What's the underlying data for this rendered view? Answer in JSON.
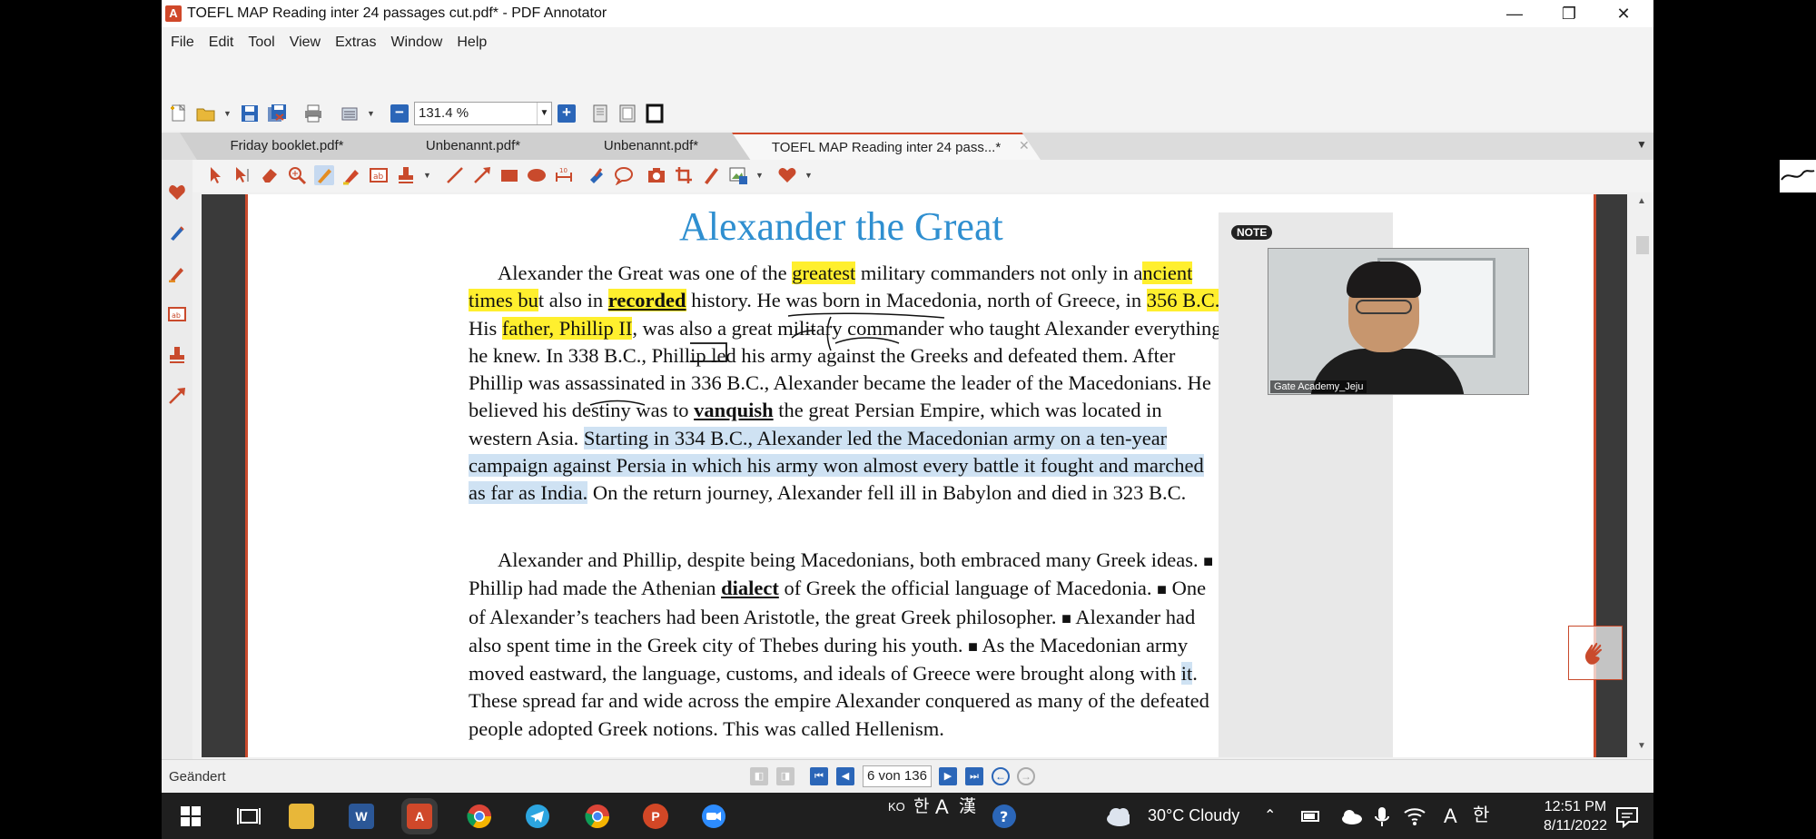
{
  "window": {
    "title": "TOEFL MAP Reading inter 24 passages cut.pdf* - PDF Annotator",
    "app_icon_letter": "A",
    "min": "—",
    "restore": "❐",
    "close": "✕"
  },
  "menu": [
    "File",
    "Edit",
    "Tool",
    "View",
    "Extras",
    "Window",
    "Help"
  ],
  "toolbar": {
    "zoom_value": "131.4 %",
    "zoom_in": "+",
    "zoom_out": "−"
  },
  "tabs": [
    {
      "label": "Friday booklet.pdf*"
    },
    {
      "label": "Unbenannt.pdf*"
    },
    {
      "label": "Unbenannt.pdf*"
    },
    {
      "label": "TOEFL MAP Reading inter 24 pass...*"
    }
  ],
  "tab_close": "✕",
  "tab_menu": "▼",
  "document": {
    "title": "Alexander the Great",
    "note_tag": "NOTE",
    "p1": {
      "s1": "Alexander the Great was one of the ",
      "h1": "greatest",
      "s2": " military commanders not only in a",
      "h2": "ncient times bu",
      "s3": "t also in ",
      "h3": "recorded",
      "s4": " history. He was born in Macedonia, north of Greece, in ",
      "h4": "356 B.C.",
      "s5": " His ",
      "h5": "father, Phillip II",
      "s6": ", was also a great military commander who taught Alexander everything he knew. In 338 B.C., Phillip led his army against the Greeks and defeated them. After Phillip was assassinated in 336 B.C., Alexander became the leader of the Macedonians. He believed his destiny was to ",
      "h6": "vanquish",
      "s7": " the great Persian Empire, which was located in western Asia. ",
      "h7": "Starting in 334 B.C., Alexander led the Macedonian army on a ten-year campaign against Persia in which his army won almost every battle it fought and marched as far as India.",
      "s8": " On the return journey, Alexander fell ill in Babylon and died in 323 B.C."
    },
    "p2": {
      "s1": "Alexander and Phillip, despite being Macedonians, both embraced many Greek ideas. ",
      "m1": "■",
      "s2": " Phillip had made the Athenian ",
      "h1": "dialect",
      "s3": " of Greek the official language of Macedonia. ",
      "m2": "■",
      "s4": " One of Alexander’s teachers had been Aristotle, the great Greek philosopher. ",
      "m3": "■",
      "s5": " Alexander had also spent time in the Greek city of Thebes during his youth. ",
      "m4": "■",
      "s6": " As the Macedonian army moved eastward, the language, customs, and ideals of Greece were brought along with ",
      "h2": "it",
      "s7": ". These spread far and wide across the empire Alexander conquered as many of the defeated people adopted Greek notions. This was called Hellenism."
    }
  },
  "webcam": {
    "label": "Gate Academy_Jeju"
  },
  "status": {
    "text": "Geändert",
    "page": "6 von 136"
  },
  "taskbar": {
    "lang": "KO",
    "ime1": "한",
    "ime2": "A",
    "ime3": "漢",
    "weather": "30°C  Cloudy",
    "time": "12:51 PM",
    "date": "8/11/2022",
    "tray_a": "A",
    "tray_ko": "한"
  },
  "colors": {
    "accent": "#d0482a",
    "title_blue": "#2f8fd0",
    "highlight_yellow": "#ffef2e",
    "highlight_blue": "#cfe2f3"
  }
}
